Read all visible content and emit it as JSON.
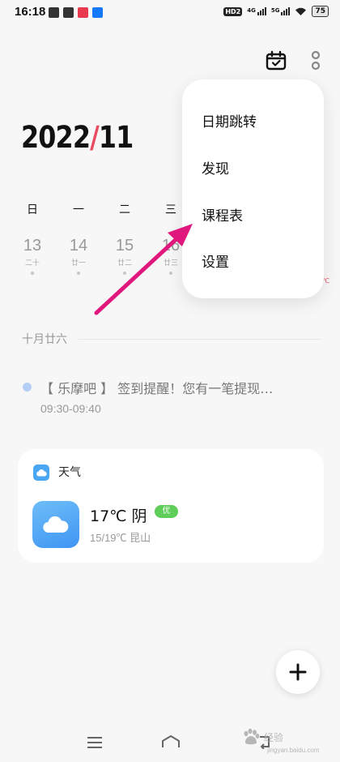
{
  "status_bar": {
    "time": "16:18",
    "hd_badge": "HD2",
    "signal_1": "4G",
    "signal_2": "5G",
    "battery": "75"
  },
  "header": {
    "month_year_left": "2022",
    "month_year_sep": "/",
    "month_year_right": "11"
  },
  "menu": {
    "items": [
      "日期跳转",
      "发现",
      "课程表",
      "设置"
    ]
  },
  "week": {
    "weekdays": [
      "日",
      "一",
      "二",
      "三"
    ],
    "days": [
      {
        "num": "13",
        "lunar": "二十"
      },
      {
        "num": "14",
        "lunar": "廿一"
      },
      {
        "num": "15",
        "lunar": "廿二"
      },
      {
        "num": "16",
        "lunar": "廿三"
      }
    ],
    "partial_text": "℃"
  },
  "date_divider": "十月廿六",
  "event": {
    "title": "【 乐摩吧 】 签到提醒！您有一笔提现…",
    "time": "09:30-09:40"
  },
  "weather": {
    "card_title": "天气",
    "temp_condition": "17℃ 阴",
    "aqi": "优",
    "range_location": "15/19℃   昆山"
  },
  "watermark": {
    "brand": "经验",
    "url": "jingyan.baidu.com"
  },
  "colors": {
    "accent": "#e84a5f",
    "arrow": "#e0187d",
    "event_dot": "#b3cff5",
    "weather_blue": "#3f95f3",
    "aqi_green": "#5fcd5a"
  }
}
